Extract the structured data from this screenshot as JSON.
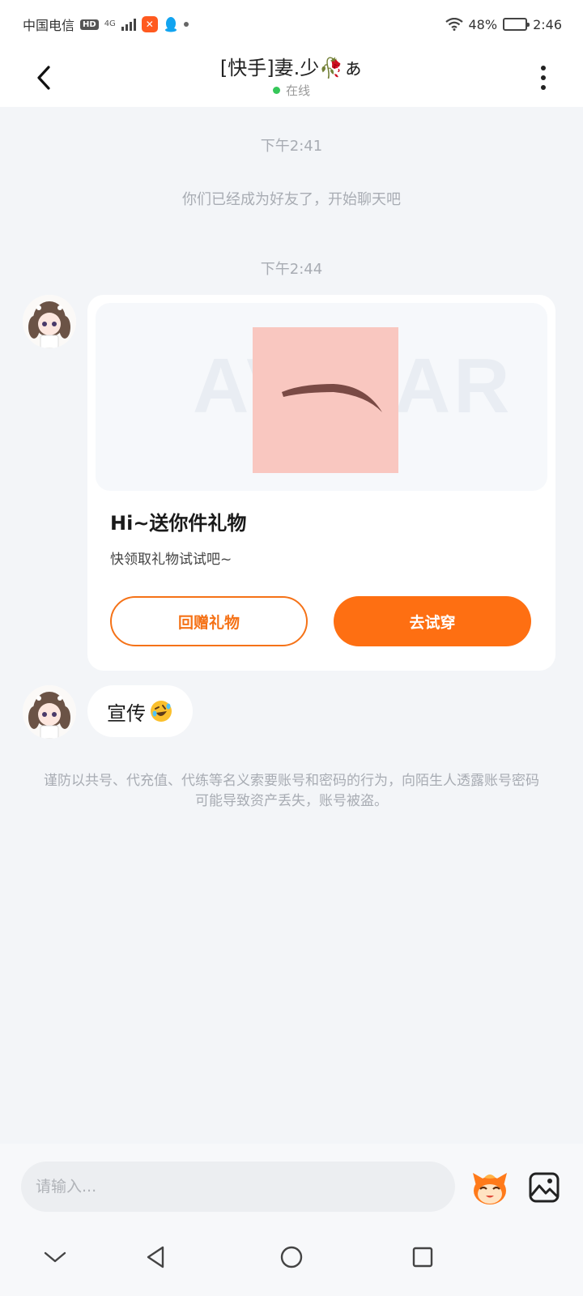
{
  "status_bar": {
    "carrier": "中国电信",
    "hd": "HD",
    "network": "4G",
    "battery": "48%",
    "battery_level": 0.48,
    "time": "2:46"
  },
  "header": {
    "title": "[快手]妻.少🥀ぁ",
    "status": "在线"
  },
  "messages": {
    "time1": "下午2:41",
    "system": "你们已经成为好友了，开始聊天吧",
    "time2": "下午2:44",
    "gift_card": {
      "title": "Hi~送你件礼物",
      "subtitle": "快领取礼物试试吧~",
      "return_button": "回赠礼物",
      "try_button": "去试穿"
    },
    "text_message": "宣传"
  },
  "warning": "谨防以共号、代充值、代练等名义索要账号和密码的行为，向陌生人透露账号密码可能导致资产丢失，账号被盗。",
  "input": {
    "placeholder": "请输入..."
  },
  "colors": {
    "accent": "#fe6f12",
    "online": "#35c759"
  }
}
